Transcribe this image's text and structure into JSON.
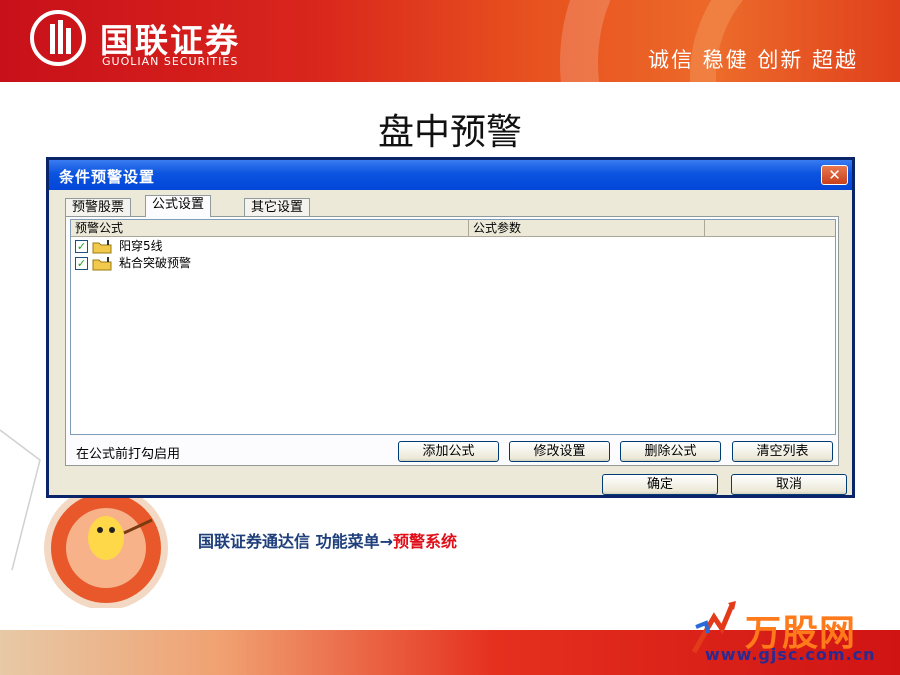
{
  "header": {
    "brand_cn": "国联证券",
    "brand_en": "GUOLIAN SECURITIES",
    "slogan": "诚信 稳健 创新 超越"
  },
  "slide_title": "盘中预警",
  "dialog": {
    "title": "条件预警设置",
    "close_glyph": "✕",
    "tabs": [
      {
        "label": "预警股票",
        "active": false
      },
      {
        "label": "公式设置",
        "active": true
      },
      {
        "label": "其它设置",
        "active": false
      }
    ],
    "columns": [
      "预警公式",
      "公式参数"
    ],
    "rows": [
      {
        "checked": true,
        "label": "阳穿5线"
      },
      {
        "checked": true,
        "label": "粘合突破预警"
      }
    ],
    "hint": "在公式前打勾启用",
    "buttons": {
      "add": "添加公式",
      "modify": "修改设置",
      "delete": "删除公式",
      "clear": "清空列表",
      "ok": "确定",
      "cancel": "取消"
    }
  },
  "caption": {
    "prefix": "国联证券通达信 功能菜单",
    "arrow": "→",
    "highlight": "预警系统"
  },
  "watermark": {
    "name": "万股网",
    "url": "www.gjsc.com.cn"
  },
  "icons": [
    "logo-mark",
    "checkbox-checked",
    "formula-folder-icon",
    "mascot-badge",
    "close-icon"
  ],
  "colors": {
    "brand_red": "#d9261c",
    "titlebar_blue": "#0b54e0",
    "caption_blue": "#1f3f7a",
    "highlight_red": "#e0101a"
  }
}
